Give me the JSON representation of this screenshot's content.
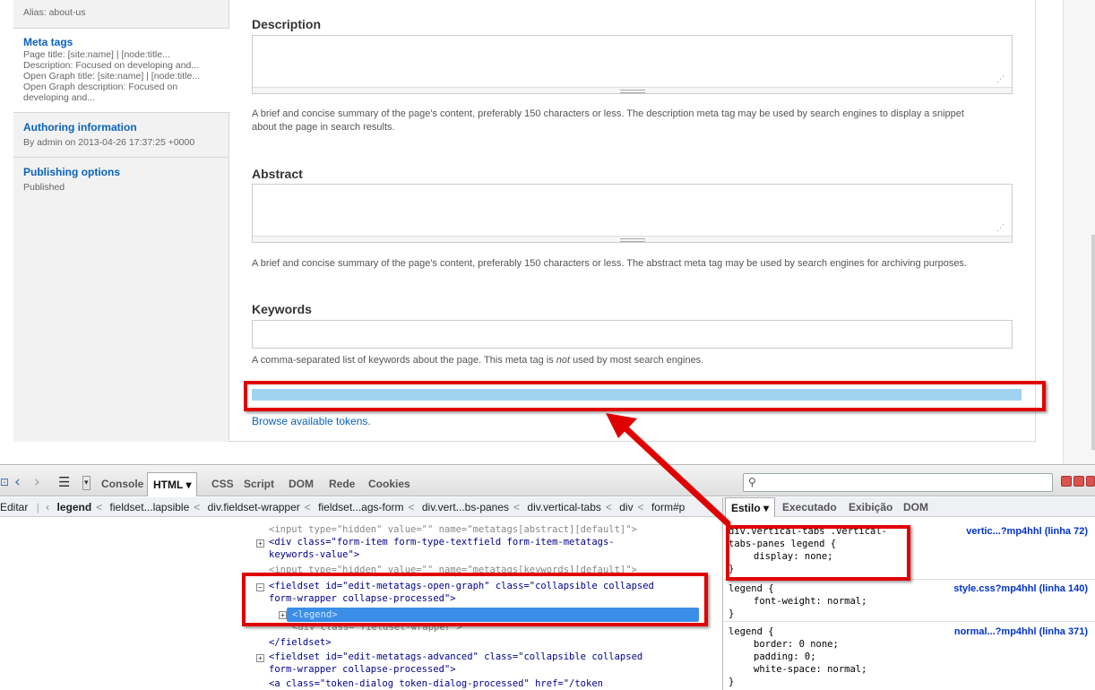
{
  "sidebar": {
    "partial_item": {
      "summary": "Alias: about-us"
    },
    "items": [
      {
        "title": "Meta tags",
        "summary_lines": [
          "Page title: [site:name] | [node:title...",
          "Description: Focused on developing and...",
          "Open Graph title: [site:name] | [node:title...",
          "Open Graph description: Focused on",
          "developing and..."
        ]
      },
      {
        "title": "Authoring information",
        "summary_lines": [
          "By admin on 2013-04-26 17:37:25 +0000"
        ]
      },
      {
        "title": "Publishing options",
        "summary_lines": [
          "Published"
        ]
      }
    ]
  },
  "form": {
    "description": {
      "label": "Description",
      "help_1": "A brief and concise summary of the page's content, preferably 150 characters or less. The description meta tag may be used by search engines to display a snippet",
      "help_2": "about the page in search results."
    },
    "abstract": {
      "label": "Abstract",
      "help": "A brief and concise summary of the page's content, preferably 150 characters or less. The abstract meta tag may be used by search engines for archiving purposes."
    },
    "keywords": {
      "label": "Keywords",
      "help_before": "A comma-separated list of keywords about the page. This meta tag is ",
      "help_em": "not",
      "help_after": " used by most search engines."
    },
    "token_link": "Browse available tokens."
  },
  "firebug": {
    "toolbar": {
      "tabs": [
        "Console",
        "HTML",
        "CSS",
        "Script",
        "DOM",
        "Rede",
        "Cookies"
      ],
      "active_tab": "HTML"
    },
    "breadcrumb": {
      "edit": "Editar",
      "items": [
        "legend",
        "fieldset...lapsible",
        "div.fieldset-wrapper",
        "fieldset...ags-form",
        "div.vert...bs-panes",
        "div.vertical-tabs",
        "div",
        "form#p"
      ]
    },
    "side_tabs": [
      "Estilo",
      "Executado",
      "Exibição",
      "DOM"
    ],
    "html_lines": [
      "<input type=\"hidden\" value=\"\" name=\"metatags[abstract][default]\">",
      "<div class=\"form-item form-type-textfield form-item-metatags-",
      "keywords-value\">",
      "<input type=\"hidden\" value=\"\" name=\"metatags[keywords][default]\">",
      "<fieldset id=\"edit-metatags-open-graph\" class=\"collapsible collapsed",
      "form-wrapper collapse-processed\">",
      "<legend>",
      "<div class=\"fieldset-wrapper\">",
      "</fieldset>",
      "<fieldset id=\"edit-metatags-advanced\" class=\"collapsible collapsed",
      "form-wrapper collapse-processed\">",
      "<a class=\"token-dialog token-dialog-processed\" href=\"/token"
    ],
    "css_rules": [
      {
        "selector_1": "div.vertical-tabs .vertical-",
        "selector_2": "tabs-panes legend {",
        "decls": [
          "display: none;"
        ],
        "source": "vertic...?mp4hhl (linha 72)"
      },
      {
        "selector_1": "legend {",
        "selector_2": "",
        "decls": [
          "font-weight: normal;"
        ],
        "source": "style.css?mp4hhl (linha 140)"
      },
      {
        "selector_1": "legend {",
        "selector_2": "",
        "decls": [
          "border: 0 none;",
          "padding: 0;",
          "white-space: normal;"
        ],
        "source": "normal...?mp4hhl (linha 371)"
      }
    ]
  },
  "colors": {
    "accent_link": "#0a63b8",
    "annotation_red": "#e00000",
    "legend_highlight": "#9fd3f0",
    "selected_node": "#3b8ee8"
  }
}
